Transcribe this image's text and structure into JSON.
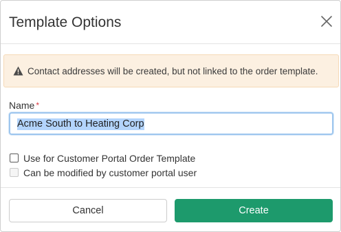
{
  "dialog": {
    "title": "Template Options",
    "close_icon": "close-x-icon"
  },
  "alert": {
    "icon": "warning-triangle-icon",
    "text": "Contact addresses will be created, but not linked to the order template."
  },
  "name_field": {
    "label": "Name",
    "required_marker": "*",
    "value": "Acme South to Heating Corp"
  },
  "options": [
    {
      "label": "Use for Customer Portal Order Template",
      "checked": false,
      "disabled": false
    },
    {
      "label": "Can be modified by customer portal user",
      "checked": false,
      "disabled": true
    }
  ],
  "footer": {
    "cancel_label": "Cancel",
    "create_label": "Create"
  },
  "colors": {
    "create_button": "#1d9a6c",
    "alert_background": "#fcf0e1",
    "required_star": "#d9363e",
    "selection_highlight": "#b3d4fc"
  }
}
